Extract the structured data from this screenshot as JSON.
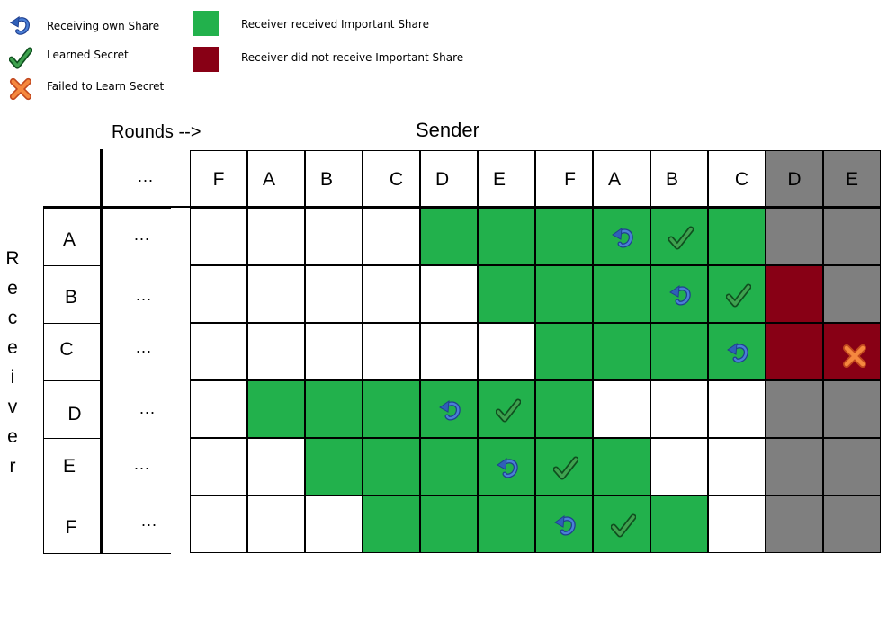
{
  "legend": {
    "receiving_own_share": "Receiving own Share",
    "learned_secret": "Learned Secret",
    "failed_to_learn": "Failed to Learn Secret",
    "received_important": "Receiver received Important Share",
    "not_received_important": "Receiver did not receive Important Share"
  },
  "labels": {
    "rounds": "Rounds -->",
    "sender": "Sender",
    "receiver_letters": [
      "R",
      "e",
      "c",
      "e",
      "i",
      "v",
      "e",
      "r"
    ],
    "ellipsis": "..."
  },
  "colors": {
    "green": "#22b14c",
    "dark_red": "#880015",
    "gray": "#7f7f7f",
    "white": "#ffffff"
  },
  "columns": [
    "F",
    "A",
    "B",
    "C",
    "D",
    "E",
    "F",
    "A",
    "B",
    "C",
    "D",
    "E"
  ],
  "rows": [
    {
      "label": "A",
      "fills": [
        "w",
        "w",
        "w",
        "w",
        "g",
        "g",
        "g",
        "g",
        "g",
        "g",
        "y",
        "y"
      ],
      "icons": [
        "",
        "",
        "",
        "",
        "",
        "",
        "",
        "return-icon",
        "check-icon",
        "",
        "",
        ""
      ]
    },
    {
      "label": "B",
      "fills": [
        "w",
        "w",
        "w",
        "w",
        "w",
        "g",
        "g",
        "g",
        "g",
        "g",
        "r",
        "y"
      ],
      "icons": [
        "",
        "",
        "",
        "",
        "",
        "",
        "",
        "",
        "return-icon",
        "check-icon",
        "",
        ""
      ]
    },
    {
      "label": "C",
      "fills": [
        "w",
        "w",
        "w",
        "w",
        "w",
        "w",
        "g",
        "g",
        "g",
        "g",
        "r",
        "r"
      ],
      "icons": [
        "",
        "",
        "",
        "",
        "",
        "",
        "",
        "",
        "",
        "return-icon",
        "",
        "cross-icon"
      ]
    },
    {
      "label": "D",
      "fills": [
        "w",
        "g",
        "g",
        "g",
        "g",
        "g",
        "g",
        "w",
        "w",
        "w",
        "y",
        "y"
      ],
      "icons": [
        "",
        "",
        "",
        "",
        "return-icon",
        "check-icon",
        "",
        "",
        "",
        "",
        "",
        ""
      ]
    },
    {
      "label": "E",
      "fills": [
        "w",
        "w",
        "g",
        "g",
        "g",
        "g",
        "g",
        "g",
        "w",
        "w",
        "y",
        "y"
      ],
      "icons": [
        "",
        "",
        "",
        "",
        "",
        "return-icon",
        "check-icon",
        "",
        "",
        "",
        "",
        ""
      ]
    },
    {
      "label": "F",
      "fills": [
        "w",
        "w",
        "w",
        "g",
        "g",
        "g",
        "g",
        "g",
        "g",
        "w",
        "y",
        "y"
      ],
      "icons": [
        "",
        "",
        "",
        "",
        "",
        "",
        "return-icon",
        "check-icon",
        "",
        "",
        "",
        ""
      ]
    }
  ]
}
